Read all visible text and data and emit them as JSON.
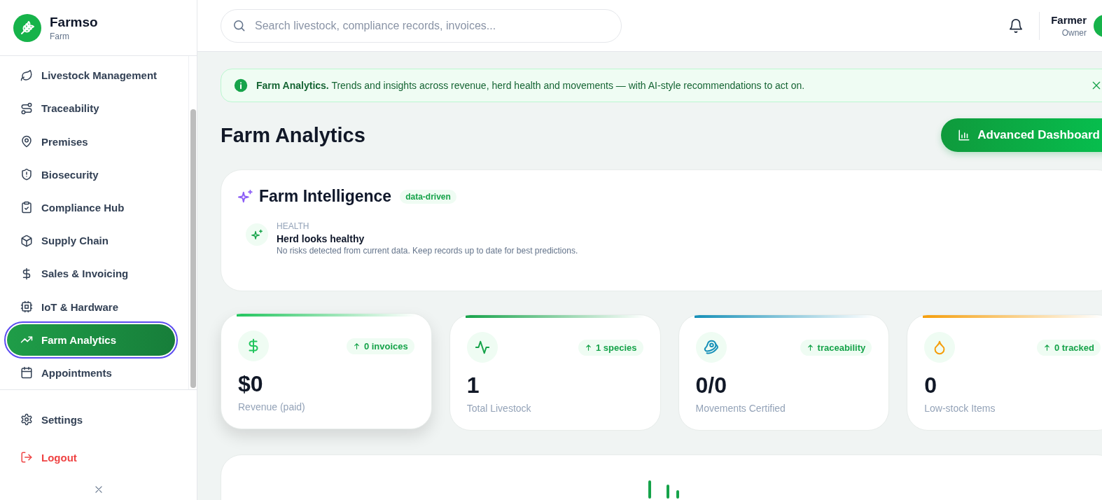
{
  "sidebar": {
    "brand": {
      "name": "Farmso",
      "subtitle": "Farm"
    },
    "items": [
      {
        "label": "Livestock Management",
        "selected": false
      },
      {
        "label": "Traceability",
        "selected": false
      },
      {
        "label": "Premises",
        "selected": false
      },
      {
        "label": "Biosecurity",
        "selected": false
      },
      {
        "label": "Compliance Hub",
        "selected": false
      },
      {
        "label": "Supply Chain",
        "selected": false
      },
      {
        "label": "Sales & Invoicing",
        "selected": false
      },
      {
        "label": "IoT & Hardware",
        "selected": false
      },
      {
        "label": "Farm Analytics",
        "selected": true
      },
      {
        "label": "Appointments",
        "selected": false
      }
    ],
    "footer_items": [
      {
        "label": "Settings",
        "kind": "normal"
      },
      {
        "label": "Logout",
        "kind": "danger"
      }
    ]
  },
  "header": {
    "search": {
      "placeholder": "Search livestock, compliance records, invoices..."
    },
    "user": {
      "name": "Farmer",
      "role": "Owner"
    }
  },
  "banner": {
    "text": "**Farm Analytics.** Trends and insights across revenue, herd health and movements — with AI-style recommendations to act on."
  },
  "page": {
    "title": "Farm Analytics",
    "action": "Advanced Dashboard"
  },
  "intelligence": {
    "title": "Farm Intelligence",
    "badge": "data-driven",
    "insights": [
      {
        "category": "HEALTH",
        "title": "Herd looks healthy",
        "description": "No risks detected from current data. Keep records up to date for best predictions."
      }
    ]
  },
  "stats": [
    {
      "color": "#22c55e",
      "trend": "0 invoices",
      "value": "$0",
      "label": "Revenue (paid)",
      "highlighted": true
    },
    {
      "color": "#16a34a",
      "trend": "1 species",
      "value": "1",
      "label": "Total Livestock",
      "highlighted": false
    },
    {
      "color": "#1690b8",
      "trend": "traceability",
      "value": "0/0",
      "label": "Movements Certified",
      "highlighted": false
    },
    {
      "color": "#f59e0b",
      "trend": "0 tracked",
      "value": "0",
      "label": "Low-stock Items",
      "highlighted": false
    }
  ]
}
